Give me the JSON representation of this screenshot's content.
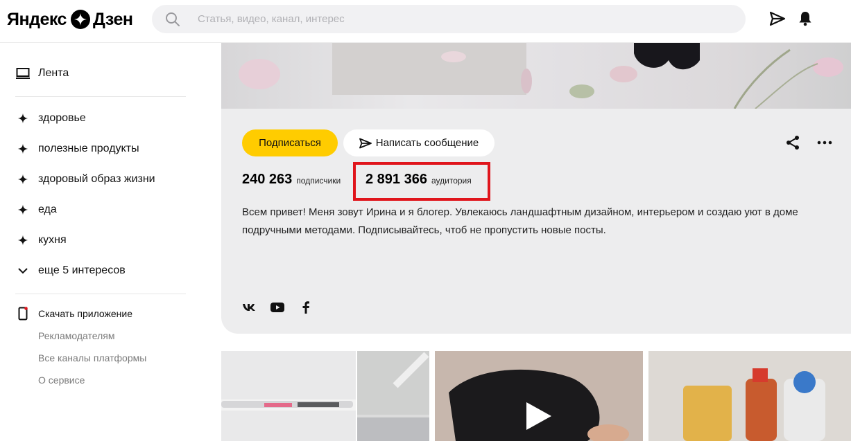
{
  "header": {
    "logo_text_left": "Яндекс",
    "logo_text_right": "Дзен",
    "search_placeholder": "Статья, видео, канал, интерес",
    "search_icon": "search-icon",
    "send_icon": "send-icon",
    "bell_icon": "bell-icon"
  },
  "sidebar": {
    "feed_label": "Лента",
    "interests": [
      {
        "label": "здоровье"
      },
      {
        "label": "полезные продукты"
      },
      {
        "label": "здоровый образ жизни"
      },
      {
        "label": "еда"
      },
      {
        "label": "кухня"
      }
    ],
    "more_label": "еще 5 интересов",
    "download_label": "Скачать приложение",
    "links": [
      {
        "label": "Рекламодателям"
      },
      {
        "label": "Все каналы платформы"
      },
      {
        "label": "О сервисе"
      }
    ]
  },
  "channel": {
    "subscribe_label": "Подписаться",
    "message_label": "Написать сообщение",
    "subscribers_value": "240 263",
    "subscribers_label": "подписчики",
    "audience_value": "2 891 366",
    "audience_label": "аудитория",
    "description": "Всем привет! Меня зовут Ирина и я блогер. Увлекаюсь ландшафтным дизайном, интерьером и создаю уют в доме подручными методами. Подписывайтесь, чтоб не пропустить новые посты.",
    "socials": [
      "vk-icon",
      "youtube-icon",
      "facebook-icon"
    ]
  },
  "colors": {
    "accent": "#ffcc00",
    "highlight": "#e0151c",
    "card_bg": "#ededee"
  }
}
